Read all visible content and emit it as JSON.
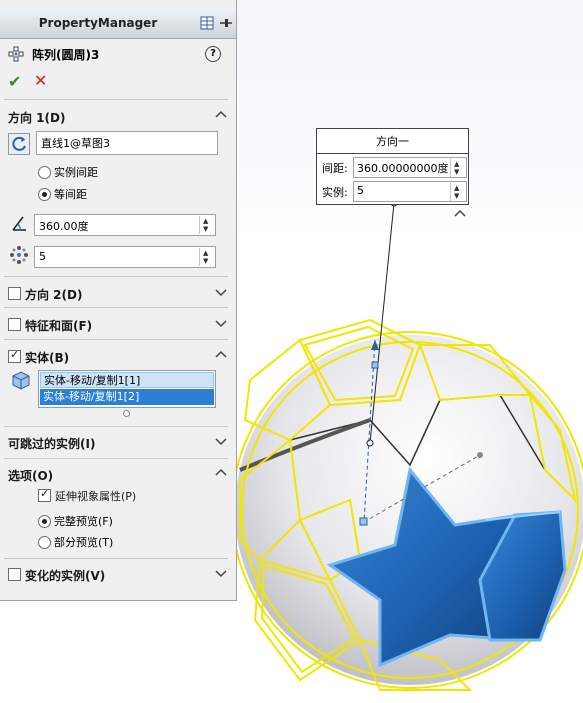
{
  "panel": {
    "title": "PropertyManager",
    "feature_name": "阵列(圆周)3",
    "help": "?",
    "ok": "✔",
    "cancel": "✕"
  },
  "direction1": {
    "label": "方向 1(D)",
    "axis_value": "直线1@草图3",
    "spacing_option1": "实例间距",
    "spacing_option2": "等间距",
    "selected_option": "等间距",
    "angle_value": "360.00度",
    "count_value": "5"
  },
  "direction2": {
    "label": "方向 2(D)",
    "checked": false
  },
  "features_faces": {
    "label": "特征和面(F)",
    "checked": false
  },
  "bodies": {
    "label": "实体(B)",
    "checked": true,
    "items": [
      "实体-移动/复制1[1]",
      "实体-移动/复制1[2]"
    ]
  },
  "skipped": {
    "label": "可跳过的实例(I)"
  },
  "options": {
    "label": "选项(O)",
    "propagate_visual": "延伸视象属性(P)",
    "propagate_checked": true,
    "full_preview": "完整预览(F)",
    "partial_preview": "部分预览(T)",
    "selected_preview": "完整预览(F)"
  },
  "varied": {
    "label": "变化的实例(V)",
    "checked": false
  },
  "callout": {
    "title": "方向一",
    "spacing_label": "间距:",
    "spacing_value": "360.00000000度",
    "count_label": "实例:",
    "count_value": "5"
  },
  "colors": {
    "accent_blue": "#2c7fd5",
    "yellow_outline": "#f2e600",
    "star_blue": "#1b5fae",
    "ok_green": "#1c9a2c",
    "cancel_red": "#d21f1f"
  }
}
